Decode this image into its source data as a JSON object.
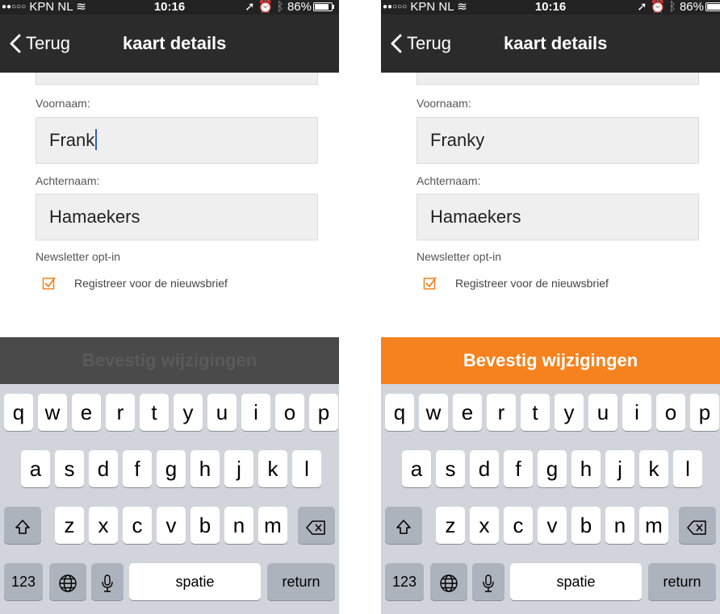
{
  "screens": [
    {
      "status": {
        "carrier": "KPN NL",
        "time": "10:16",
        "battery": "86%",
        "battery_level": 0.86
      },
      "nav": {
        "back_label": "Terug",
        "title": "kaart details"
      },
      "form": {
        "first_name_label": "Voornaam:",
        "first_name_value": "Frank",
        "last_name_label": "Achternaam:",
        "last_name_value": "Hamaekers",
        "newsletter_label": "Newsletter opt-in",
        "newsletter_checkbox_label": "Registreer voor de nieuwsbrief",
        "newsletter_checked": true
      },
      "confirm_label": "Bevestig wijzigingen",
      "confirm_enabled": false
    },
    {
      "status": {
        "carrier": "KPN NL",
        "time": "10:16",
        "battery": "86%",
        "battery_level": 0.86
      },
      "nav": {
        "back_label": "Terug",
        "title": "kaart details"
      },
      "form": {
        "first_name_label": "Voornaam:",
        "first_name_value": "Franky",
        "last_name_label": "Achternaam:",
        "last_name_value": "Hamaekers",
        "newsletter_label": "Newsletter opt-in",
        "newsletter_checkbox_label": "Registreer voor de nieuwsbrief",
        "newsletter_checked": true
      },
      "confirm_label": "Bevestig wijzigingen",
      "confirm_enabled": true
    }
  ],
  "keyboard": {
    "row1": [
      "q",
      "w",
      "e",
      "r",
      "t",
      "y",
      "u",
      "i",
      "o",
      "p"
    ],
    "row2": [
      "a",
      "s",
      "d",
      "f",
      "g",
      "h",
      "j",
      "k",
      "l"
    ],
    "row3": [
      "z",
      "x",
      "c",
      "v",
      "b",
      "n",
      "m"
    ],
    "numbers_key": "123",
    "space_key": "spatie",
    "return_key": "return"
  },
  "colors": {
    "accent": "#f5821f",
    "navbar": "#2b2b2b",
    "disabled_button": "#4a4a4a",
    "keyboard_bg": "#d1d5db"
  }
}
